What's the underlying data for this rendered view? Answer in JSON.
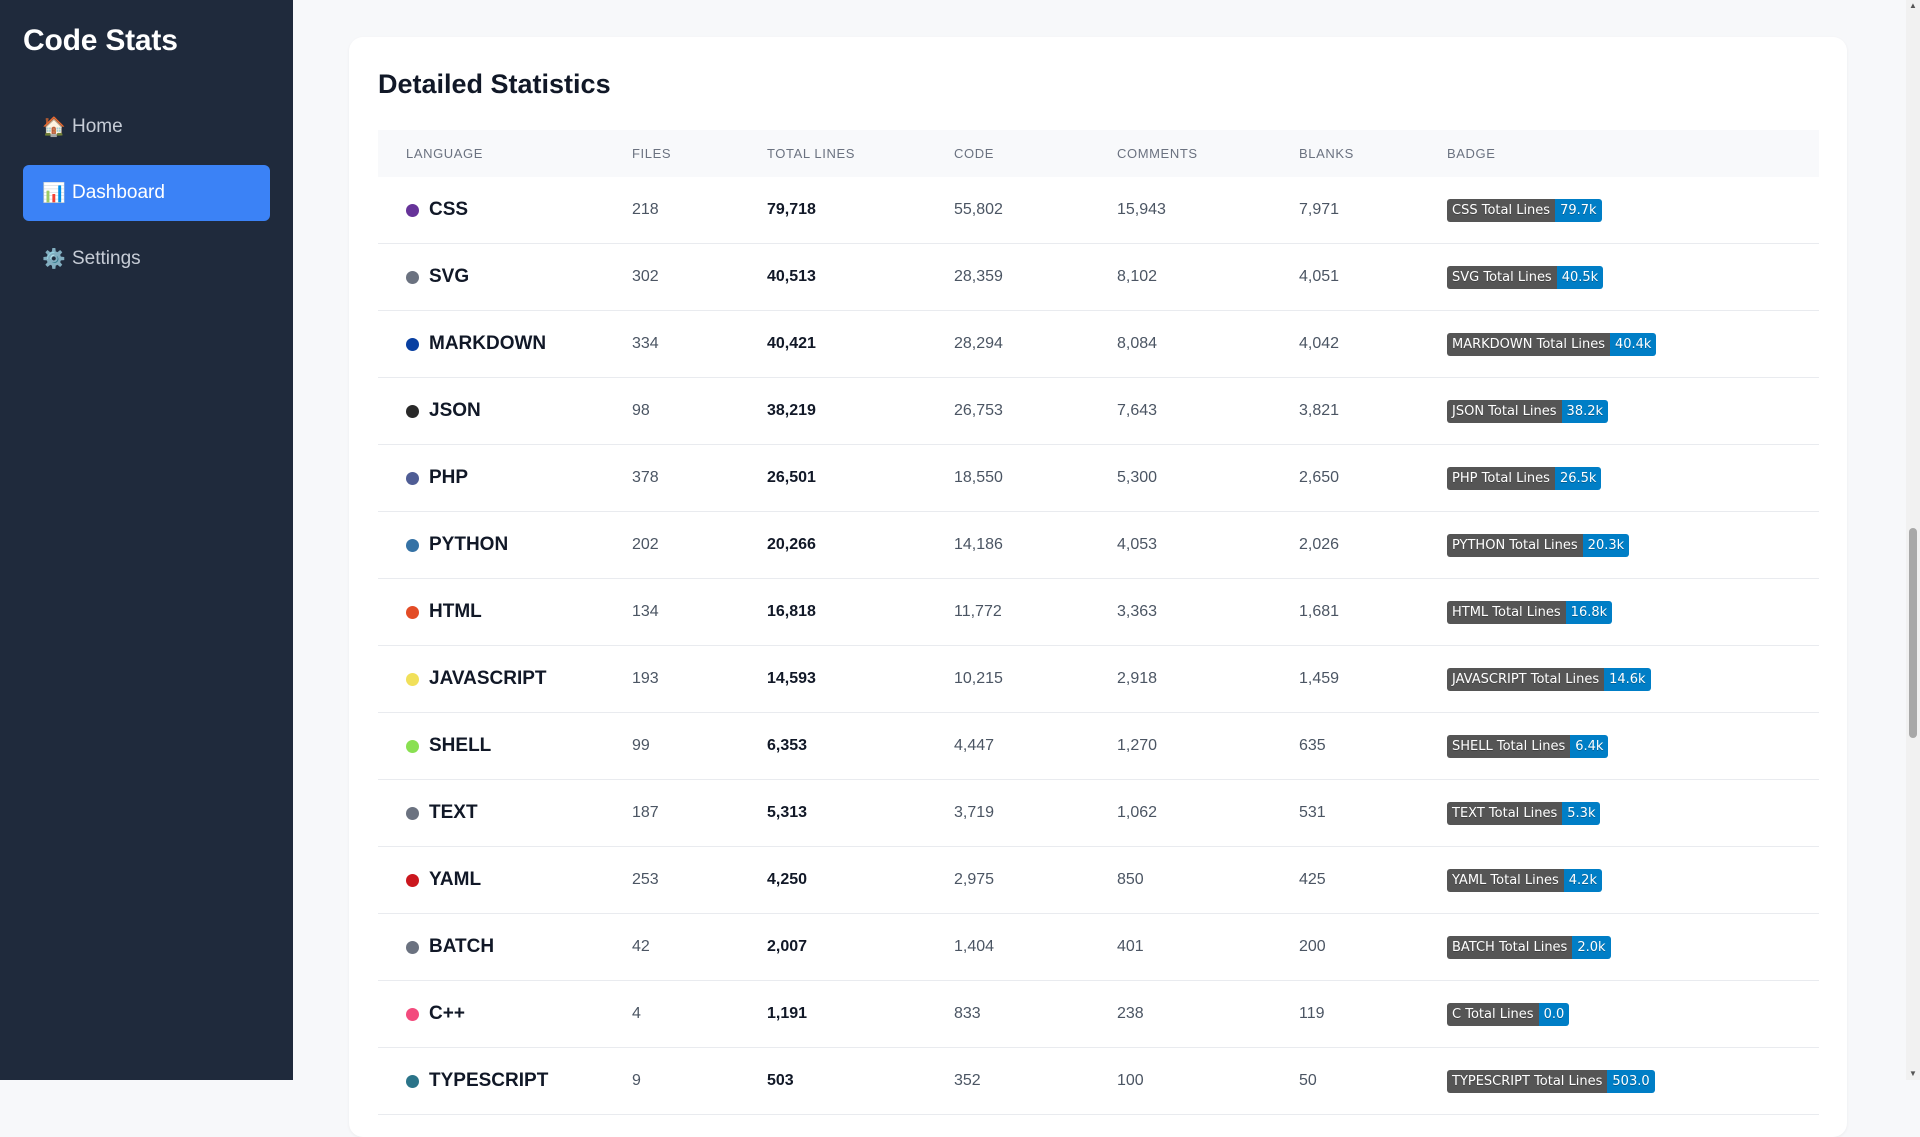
{
  "sidebar": {
    "brand": "Code Stats",
    "items": [
      {
        "label": "Home",
        "icon": "🏠",
        "active": false
      },
      {
        "label": "Dashboard",
        "icon": "📊",
        "active": true
      },
      {
        "label": "Settings",
        "icon": "⚙️",
        "active": false
      }
    ]
  },
  "main": {
    "title": "Detailed Statistics",
    "columns": [
      "LANGUAGE",
      "FILES",
      "TOTAL LINES",
      "CODE",
      "COMMENTS",
      "BLANKS",
      "BADGE"
    ],
    "rows": [
      {
        "language": "CSS",
        "color": "#663399",
        "files": "218",
        "total": "79,718",
        "code": "55,802",
        "comments": "15,943",
        "blanks": "7,971",
        "badge_label": "CSS Total Lines",
        "badge_value": "79.7k"
      },
      {
        "language": "SVG",
        "color": "#6b7280",
        "files": "302",
        "total": "40,513",
        "code": "28,359",
        "comments": "8,102",
        "blanks": "4,051",
        "badge_label": "SVG Total Lines",
        "badge_value": "40.5k"
      },
      {
        "language": "MARKDOWN",
        "color": "#083fa1",
        "files": "334",
        "total": "40,421",
        "code": "28,294",
        "comments": "8,084",
        "blanks": "4,042",
        "badge_label": "MARKDOWN Total Lines",
        "badge_value": "40.4k"
      },
      {
        "language": "JSON",
        "color": "#292929",
        "files": "98",
        "total": "38,219",
        "code": "26,753",
        "comments": "7,643",
        "blanks": "3,821",
        "badge_label": "JSON Total Lines",
        "badge_value": "38.2k"
      },
      {
        "language": "PHP",
        "color": "#4f5d95",
        "files": "378",
        "total": "26,501",
        "code": "18,550",
        "comments": "5,300",
        "blanks": "2,650",
        "badge_label": "PHP Total Lines",
        "badge_value": "26.5k"
      },
      {
        "language": "PYTHON",
        "color": "#3572a5",
        "files": "202",
        "total": "20,266",
        "code": "14,186",
        "comments": "4,053",
        "blanks": "2,026",
        "badge_label": "PYTHON Total Lines",
        "badge_value": "20.3k"
      },
      {
        "language": "HTML",
        "color": "#e34c26",
        "files": "134",
        "total": "16,818",
        "code": "11,772",
        "comments": "3,363",
        "blanks": "1,681",
        "badge_label": "HTML Total Lines",
        "badge_value": "16.8k"
      },
      {
        "language": "JAVASCRIPT",
        "color": "#f1e05a",
        "files": "193",
        "total": "14,593",
        "code": "10,215",
        "comments": "2,918",
        "blanks": "1,459",
        "badge_label": "JAVASCRIPT Total Lines",
        "badge_value": "14.6k"
      },
      {
        "language": "SHELL",
        "color": "#89e051",
        "files": "99",
        "total": "6,353",
        "code": "4,447",
        "comments": "1,270",
        "blanks": "635",
        "badge_label": "SHELL Total Lines",
        "badge_value": "6.4k"
      },
      {
        "language": "TEXT",
        "color": "#6b7280",
        "files": "187",
        "total": "5,313",
        "code": "3,719",
        "comments": "1,062",
        "blanks": "531",
        "badge_label": "TEXT Total Lines",
        "badge_value": "5.3k"
      },
      {
        "language": "YAML",
        "color": "#cb171e",
        "files": "253",
        "total": "4,250",
        "code": "2,975",
        "comments": "850",
        "blanks": "425",
        "badge_label": "YAML Total Lines",
        "badge_value": "4.2k"
      },
      {
        "language": "BATCH",
        "color": "#6b7280",
        "files": "42",
        "total": "2,007",
        "code": "1,404",
        "comments": "401",
        "blanks": "200",
        "badge_label": "BATCH Total Lines",
        "badge_value": "2.0k"
      },
      {
        "language": "C++",
        "color": "#f34b7d",
        "files": "4",
        "total": "1,191",
        "code": "833",
        "comments": "238",
        "blanks": "119",
        "badge_label": "C Total Lines",
        "badge_value": "0.0"
      },
      {
        "language": "TYPESCRIPT",
        "color": "#2b7489",
        "files": "9",
        "total": "503",
        "code": "352",
        "comments": "100",
        "blanks": "50",
        "badge_label": "TYPESCRIPT Total Lines",
        "badge_value": "503.0"
      }
    ]
  }
}
